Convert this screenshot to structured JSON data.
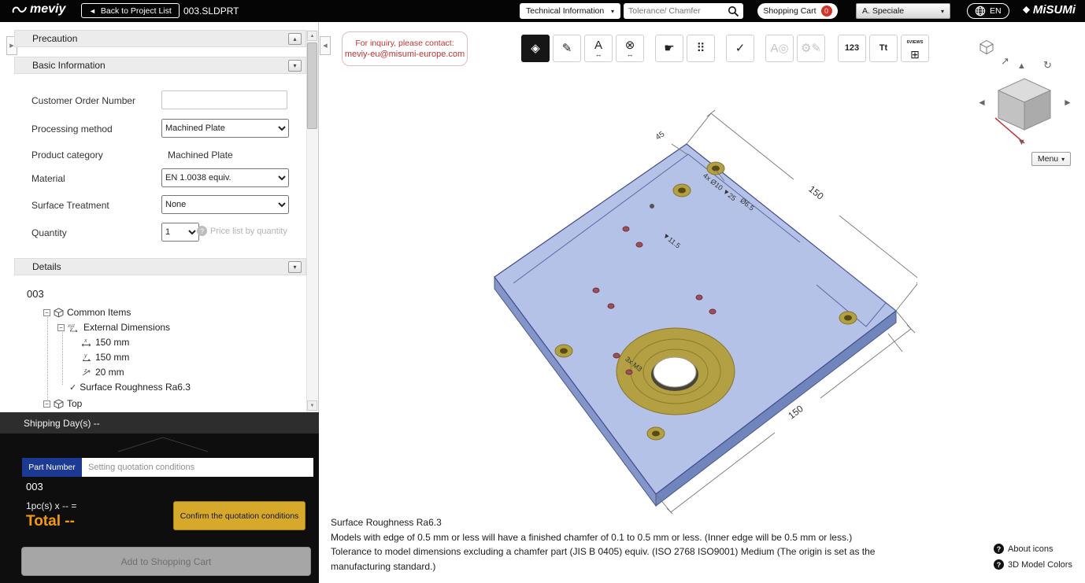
{
  "icons": {
    "back": "◄",
    "chevron_down": "▾",
    "chevron_up": "▴",
    "collapse_left": "◀",
    "collapse_right": "▶",
    "arrow_up": "▲",
    "arrow_down": "▼",
    "arrow_left": "◄",
    "arrow_right": "►",
    "iso_arrow": "↗",
    "rotate_cw": "↻",
    "help": "?",
    "minus": "−",
    "check": "✓",
    "select_arrow": "▾"
  },
  "topbar": {
    "logo_text": "meviy",
    "back_button": "Back to Project List",
    "file_name": "003.SLDPRT",
    "tech_info": "Technical Information",
    "search_placeholder": "Tolerance/ Chamfer",
    "cart_label": "Shopping Cart",
    "cart_count": "0",
    "account": "A. Speciale",
    "language": "EN",
    "brand_text": "MiSUMi"
  },
  "sidebar": {
    "sections": {
      "precaution": "Precaution",
      "basic_info": "Basic Information",
      "details": "Details"
    },
    "form": {
      "customer_order_number": {
        "label": "Customer Order Number",
        "value": ""
      },
      "processing_method": {
        "label": "Processing method",
        "value": "Machined Plate"
      },
      "product_category": {
        "label": "Product category",
        "value": "Machined Plate"
      },
      "material": {
        "label": "Material",
        "value": "EN 1.0038 equiv."
      },
      "surface_treatment": {
        "label": "Surface Treatment",
        "value": "None"
      },
      "quantity": {
        "label": "Quantity",
        "value": "1",
        "link": "Price list by quantity"
      }
    },
    "tree": {
      "root": "003",
      "common_items": "Common Items",
      "external_dimensions": "External Dimensions",
      "dim_x": "150 mm",
      "dim_y": "150 mm",
      "dim_z": "20 mm",
      "surface_roughness": "Surface Roughness Ra6.3",
      "top_face": "Top"
    }
  },
  "quote": {
    "shipping_days": "Shipping Day(s) --",
    "part_number_tab": "Part Number",
    "conditions_placeholder": "Setting quotation conditions",
    "part_id": "003",
    "quantity_line": "1pc(s) x -- =",
    "total_line": "Total --",
    "confirm_button": "Confirm the quotation conditions",
    "add_to_cart_button": "Add to Shopping Cart"
  },
  "viewer": {
    "inquiry_label": "For inquiry, please contact:",
    "inquiry_email": "meviy-eu@misumi-europe.com",
    "menu_button": "Menu",
    "toolbar_icons": [
      {
        "name": "datum-target",
        "glyph": "◈"
      },
      {
        "name": "edit-measure",
        "glyph": "✎"
      },
      {
        "name": "dimension-text",
        "glyph": "A",
        "sub": "↔"
      },
      {
        "name": "dimension-remove",
        "glyph": "⊗",
        "sub": "↔"
      },
      {
        "name": "move-part",
        "glyph": "☛"
      },
      {
        "name": "hole-pattern",
        "glyph": "⠿"
      },
      {
        "name": "surface-check",
        "glyph": "✓"
      },
      {
        "name": "annotation-zoom",
        "glyph": "A◎"
      },
      {
        "name": "settings-edit",
        "glyph": "⚙✎"
      },
      {
        "name": "numbering",
        "glyph": "123"
      },
      {
        "name": "text-style",
        "glyph": "Tt"
      },
      {
        "name": "six-views",
        "glyph": "6VIEWS",
        "sub": "⊞"
      }
    ],
    "annotations": {
      "chamfer45": "45",
      "cb_callout": "4x Ø10 ▼25",
      "dia65": "Ø6.5",
      "depth115": "▼11.5",
      "dim_top": "150",
      "m3_callout": "3x M3",
      "dim_bottom": "150"
    },
    "notes": [
      "Surface Roughness Ra6.3",
      "Models with edge of 0.5 mm or less will have a finished chamfer of 0.1 to 0.5 mm or less. (Inner edge will be 0.5 mm or less.)",
      "Tolerance to model dimensions excluding a chamfer part (JIS B 0405) equiv. (ISO 2768 ISO9001) Medium (The origin is set as the manufacturing standard.)"
    ],
    "help_about_icons": "About icons",
    "help_model_colors": "3D Model Colors"
  },
  "colors": {
    "accent_orange": "#f59b00",
    "confirm_yellow": "#d7a92a",
    "part_tab_blue": "#1c3a94",
    "cart_badge_red": "#d93025",
    "model_blue": "#b5c2e7",
    "model_gold": "#b2a043",
    "inquiry_red": "#c03333"
  }
}
